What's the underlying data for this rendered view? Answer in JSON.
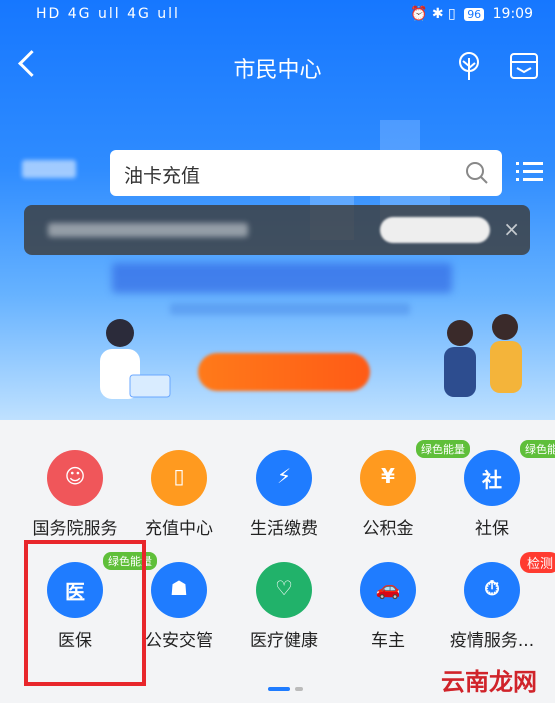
{
  "status_bar": {
    "left": "HD 4G ull 4G ull",
    "battery": "96",
    "time": "19:09"
  },
  "header": {
    "title": "市民中心"
  },
  "search": {
    "placeholder": "油卡充值"
  },
  "services": [
    {
      "label": "国务院服务",
      "color": "#f0565a",
      "icon": "state-council-icon",
      "badge": ""
    },
    {
      "label": "充值中心",
      "color": "#ff9a1f",
      "icon": "phone-recharge-icon",
      "badge": ""
    },
    {
      "label": "生活缴费",
      "color": "#1f7cff",
      "icon": "lightning-icon",
      "badge": ""
    },
    {
      "label": "公积金",
      "color": "#ff9a1f",
      "icon": "house-fund-icon",
      "badge": "绿色能量"
    },
    {
      "label": "社保",
      "color": "#1f7cff",
      "icon": "social-security-icon",
      "badge": "绿色能量"
    },
    {
      "label": "医保",
      "color": "#1f7cff",
      "icon": "medical-insurance-icon",
      "badge": "绿色能量"
    },
    {
      "label": "公安交管",
      "color": "#1f7cff",
      "icon": "police-icon",
      "badge": ""
    },
    {
      "label": "医疗健康",
      "color": "#21b26a",
      "icon": "health-icon",
      "badge": ""
    },
    {
      "label": "车主",
      "color": "#1f7cff",
      "icon": "car-icon",
      "badge": ""
    },
    {
      "label": "疫情服务...",
      "color": "#1f7cff",
      "icon": "epidemic-clock-icon",
      "badge": "检测"
    }
  ],
  "glyphs": [
    "☺",
    "▯",
    "⚡",
    "¥",
    "社",
    "医",
    "☗",
    "♡",
    "🚗",
    "⏱"
  ],
  "watermark": "云南龙网"
}
